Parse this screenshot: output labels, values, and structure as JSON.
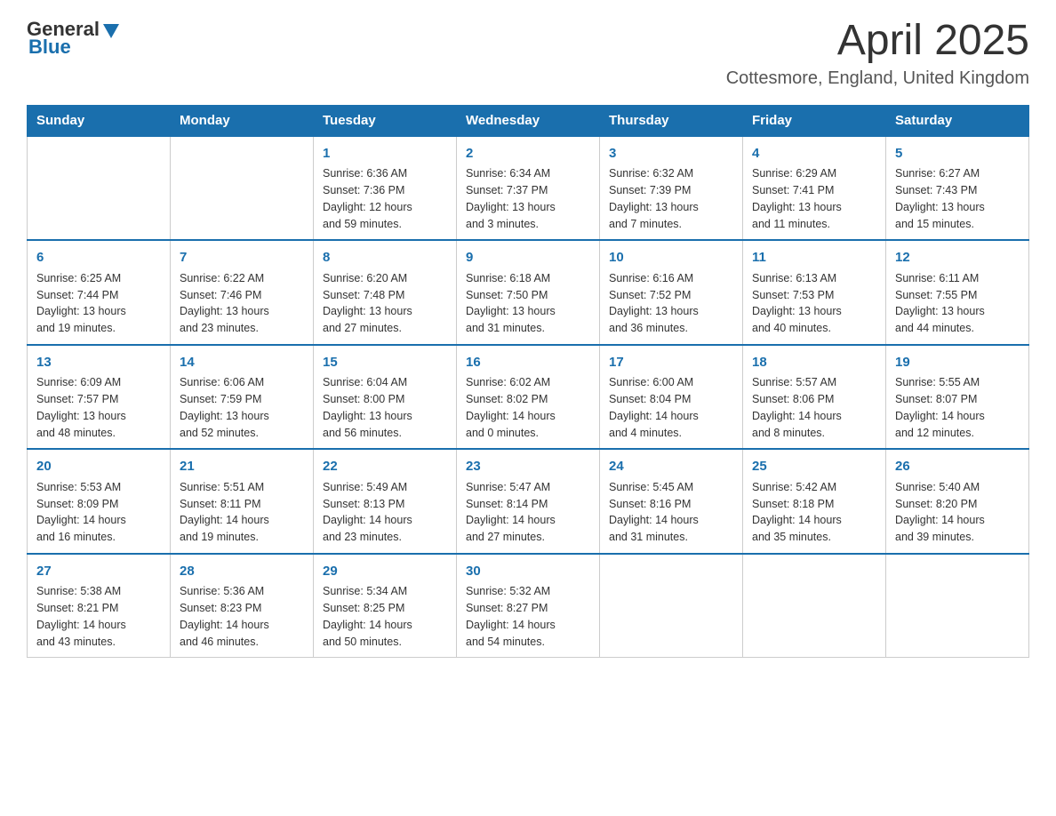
{
  "header": {
    "logo_general": "General",
    "logo_blue": "Blue",
    "title": "April 2025",
    "subtitle": "Cottesmore, England, United Kingdom"
  },
  "calendar": {
    "days_of_week": [
      "Sunday",
      "Monday",
      "Tuesday",
      "Wednesday",
      "Thursday",
      "Friday",
      "Saturday"
    ],
    "weeks": [
      [
        {
          "day": "",
          "info": ""
        },
        {
          "day": "",
          "info": ""
        },
        {
          "day": "1",
          "info": "Sunrise: 6:36 AM\nSunset: 7:36 PM\nDaylight: 12 hours\nand 59 minutes."
        },
        {
          "day": "2",
          "info": "Sunrise: 6:34 AM\nSunset: 7:37 PM\nDaylight: 13 hours\nand 3 minutes."
        },
        {
          "day": "3",
          "info": "Sunrise: 6:32 AM\nSunset: 7:39 PM\nDaylight: 13 hours\nand 7 minutes."
        },
        {
          "day": "4",
          "info": "Sunrise: 6:29 AM\nSunset: 7:41 PM\nDaylight: 13 hours\nand 11 minutes."
        },
        {
          "day": "5",
          "info": "Sunrise: 6:27 AM\nSunset: 7:43 PM\nDaylight: 13 hours\nand 15 minutes."
        }
      ],
      [
        {
          "day": "6",
          "info": "Sunrise: 6:25 AM\nSunset: 7:44 PM\nDaylight: 13 hours\nand 19 minutes."
        },
        {
          "day": "7",
          "info": "Sunrise: 6:22 AM\nSunset: 7:46 PM\nDaylight: 13 hours\nand 23 minutes."
        },
        {
          "day": "8",
          "info": "Sunrise: 6:20 AM\nSunset: 7:48 PM\nDaylight: 13 hours\nand 27 minutes."
        },
        {
          "day": "9",
          "info": "Sunrise: 6:18 AM\nSunset: 7:50 PM\nDaylight: 13 hours\nand 31 minutes."
        },
        {
          "day": "10",
          "info": "Sunrise: 6:16 AM\nSunset: 7:52 PM\nDaylight: 13 hours\nand 36 minutes."
        },
        {
          "day": "11",
          "info": "Sunrise: 6:13 AM\nSunset: 7:53 PM\nDaylight: 13 hours\nand 40 minutes."
        },
        {
          "day": "12",
          "info": "Sunrise: 6:11 AM\nSunset: 7:55 PM\nDaylight: 13 hours\nand 44 minutes."
        }
      ],
      [
        {
          "day": "13",
          "info": "Sunrise: 6:09 AM\nSunset: 7:57 PM\nDaylight: 13 hours\nand 48 minutes."
        },
        {
          "day": "14",
          "info": "Sunrise: 6:06 AM\nSunset: 7:59 PM\nDaylight: 13 hours\nand 52 minutes."
        },
        {
          "day": "15",
          "info": "Sunrise: 6:04 AM\nSunset: 8:00 PM\nDaylight: 13 hours\nand 56 minutes."
        },
        {
          "day": "16",
          "info": "Sunrise: 6:02 AM\nSunset: 8:02 PM\nDaylight: 14 hours\nand 0 minutes."
        },
        {
          "day": "17",
          "info": "Sunrise: 6:00 AM\nSunset: 8:04 PM\nDaylight: 14 hours\nand 4 minutes."
        },
        {
          "day": "18",
          "info": "Sunrise: 5:57 AM\nSunset: 8:06 PM\nDaylight: 14 hours\nand 8 minutes."
        },
        {
          "day": "19",
          "info": "Sunrise: 5:55 AM\nSunset: 8:07 PM\nDaylight: 14 hours\nand 12 minutes."
        }
      ],
      [
        {
          "day": "20",
          "info": "Sunrise: 5:53 AM\nSunset: 8:09 PM\nDaylight: 14 hours\nand 16 minutes."
        },
        {
          "day": "21",
          "info": "Sunrise: 5:51 AM\nSunset: 8:11 PM\nDaylight: 14 hours\nand 19 minutes."
        },
        {
          "day": "22",
          "info": "Sunrise: 5:49 AM\nSunset: 8:13 PM\nDaylight: 14 hours\nand 23 minutes."
        },
        {
          "day": "23",
          "info": "Sunrise: 5:47 AM\nSunset: 8:14 PM\nDaylight: 14 hours\nand 27 minutes."
        },
        {
          "day": "24",
          "info": "Sunrise: 5:45 AM\nSunset: 8:16 PM\nDaylight: 14 hours\nand 31 minutes."
        },
        {
          "day": "25",
          "info": "Sunrise: 5:42 AM\nSunset: 8:18 PM\nDaylight: 14 hours\nand 35 minutes."
        },
        {
          "day": "26",
          "info": "Sunrise: 5:40 AM\nSunset: 8:20 PM\nDaylight: 14 hours\nand 39 minutes."
        }
      ],
      [
        {
          "day": "27",
          "info": "Sunrise: 5:38 AM\nSunset: 8:21 PM\nDaylight: 14 hours\nand 43 minutes."
        },
        {
          "day": "28",
          "info": "Sunrise: 5:36 AM\nSunset: 8:23 PM\nDaylight: 14 hours\nand 46 minutes."
        },
        {
          "day": "29",
          "info": "Sunrise: 5:34 AM\nSunset: 8:25 PM\nDaylight: 14 hours\nand 50 minutes."
        },
        {
          "day": "30",
          "info": "Sunrise: 5:32 AM\nSunset: 8:27 PM\nDaylight: 14 hours\nand 54 minutes."
        },
        {
          "day": "",
          "info": ""
        },
        {
          "day": "",
          "info": ""
        },
        {
          "day": "",
          "info": ""
        }
      ]
    ]
  }
}
